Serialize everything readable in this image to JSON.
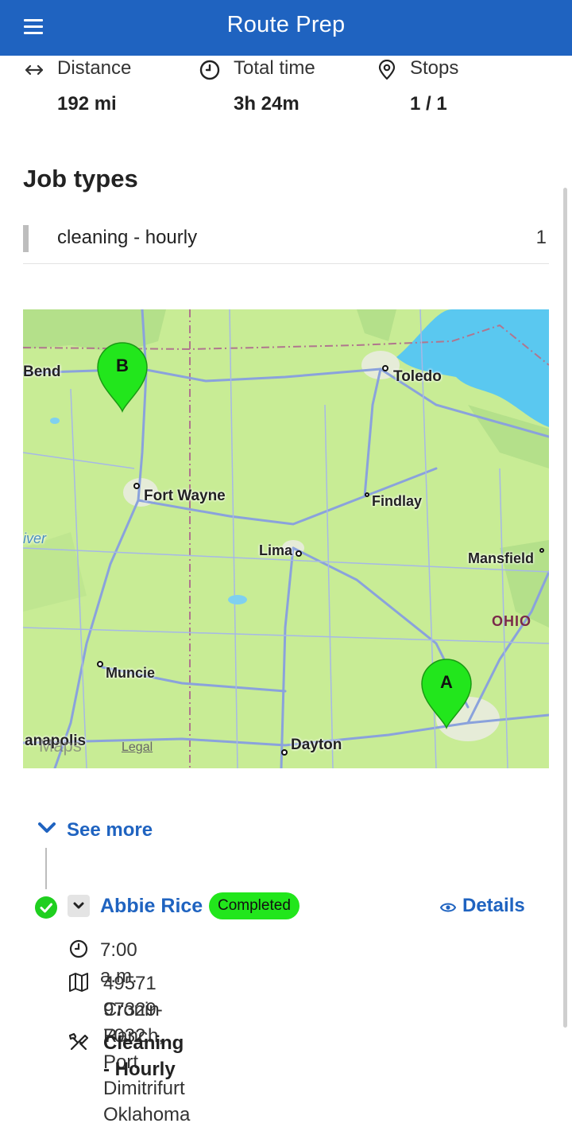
{
  "app": {
    "title": "Route Prep"
  },
  "stats": {
    "distance": {
      "label": "Distance",
      "value": "192 mi"
    },
    "total_time": {
      "label": "Total time",
      "value": "3h 24m"
    },
    "stops": {
      "label": "Stops",
      "value": "1 / 1"
    }
  },
  "job_types": {
    "title": "Job types",
    "items": [
      {
        "name": "cleaning - hourly",
        "count": "1"
      }
    ]
  },
  "map": {
    "cities": {
      "bend": "Bend",
      "toledo": "Toledo",
      "fort_wayne": "Fort Wayne",
      "findlay": "Findlay",
      "lima": "Lima",
      "mansfield": "Mansfield",
      "muncie": "Muncie",
      "dayton": "Dayton",
      "indianapolis": "anapolis",
      "river": "iver"
    },
    "state_label": "OHIO",
    "brand": "Maps",
    "legal": "Legal",
    "pins": {
      "a": "A",
      "b": "B"
    },
    "colors": {
      "land": "#c8ec95",
      "water": "#5ac8f0",
      "pin": "#22e61c",
      "road": "#8aa2dc"
    }
  },
  "see_more": "See more",
  "stop": {
    "name": "Abbie Rice",
    "status": "Completed",
    "details_label": "Details",
    "time": "7:00 a.m.",
    "address_line1": "49571 Cronin Ranch, Port Dimitrifurt Oklahoma",
    "address_line2": "97329-7032",
    "job_type": "Cleaning - Hourly"
  },
  "icons": {
    "menu": "menu-icon",
    "distance": "arrows-horizontal-icon",
    "time": "clock-icon",
    "stops": "map-pin-icon",
    "chevron": "chevron-down-icon",
    "check": "check-circle-icon",
    "eye": "eye-icon",
    "map": "map-icon",
    "tools": "tools-icon"
  },
  "colors": {
    "primary": "#1f63c0",
    "success": "#22e61c"
  }
}
